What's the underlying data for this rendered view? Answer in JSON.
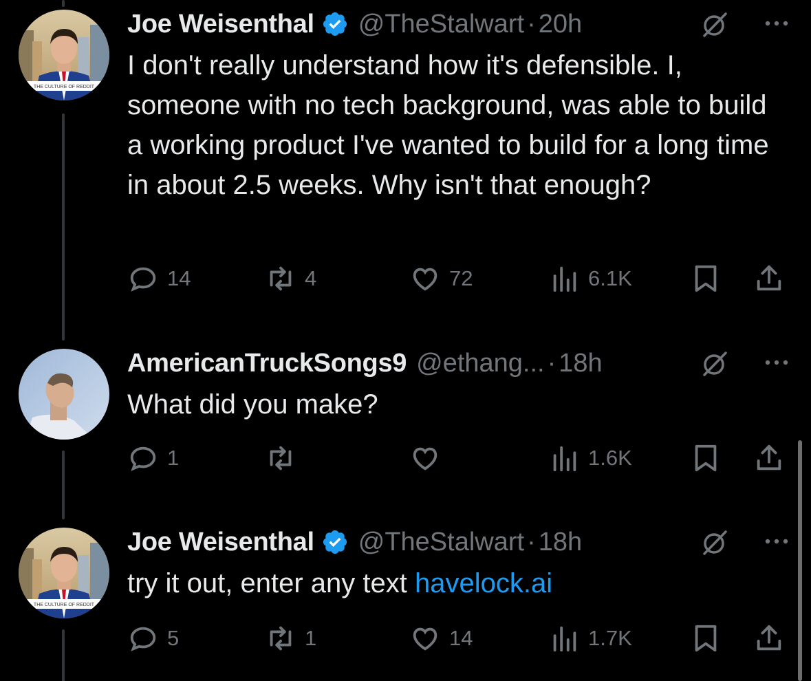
{
  "colors": {
    "background": "#000000",
    "text": "#e7e9ea",
    "muted": "#71767b",
    "link": "#1d9bf0",
    "verified": "#1d9bf0"
  },
  "tweets": [
    {
      "name": "Joe Weisenthal",
      "verified": true,
      "handle": "@TheStalwart",
      "time": "20h",
      "avatar_caption": "THE CULTURE OF REDDIT",
      "text": "I don't really understand how it's defensible. I, someone with no tech background, was able to build a working product I've wanted to build for a long time in about 2.5 weeks. Why isn't that enough?",
      "link": "",
      "replies": "14",
      "reposts": "4",
      "likes": "72",
      "views": "6.1K"
    },
    {
      "name": "AmericanTruckSongs9",
      "verified": false,
      "handle": "@ethang...",
      "time": "18h",
      "avatar_caption": "",
      "text": "What did you make?",
      "link": "",
      "replies": "1",
      "reposts": "",
      "likes": "",
      "views": "1.6K"
    },
    {
      "name": "Joe Weisenthal",
      "verified": true,
      "handle": "@TheStalwart",
      "time": "18h",
      "avatar_caption": "THE CULTURE OF REDDIT",
      "text": "try it out, enter any text ",
      "link": "havelock.ai",
      "replies": "5",
      "reposts": "1",
      "likes": "14",
      "views": "1.7K"
    }
  ],
  "icons": {
    "reply": "reply-icon",
    "repost": "repost-icon",
    "like": "heart-icon",
    "views": "views-icon",
    "bookmark": "bookmark-icon",
    "share": "share-icon",
    "grok": "grok-icon",
    "more": "more-icon",
    "verified": "verified-badge-icon"
  }
}
